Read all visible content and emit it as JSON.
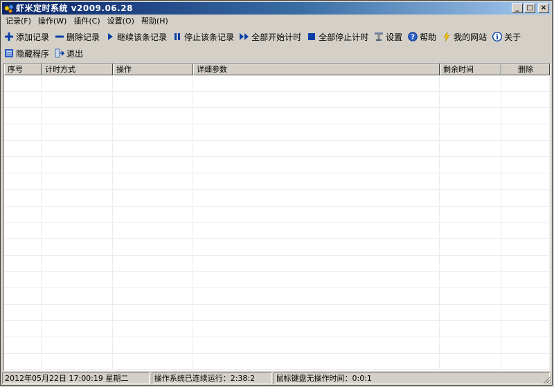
{
  "window": {
    "title": "虾米定时系统 v2009.06.28",
    "controls": {
      "minimize": "_",
      "maximize": "□",
      "close": "×"
    }
  },
  "menu": [
    "记录(F)",
    "操作(W)",
    "插件(C)",
    "设置(O)",
    "帮助(H)"
  ],
  "toolbar1": [
    {
      "label": "添加记录",
      "icon": "plus-icon"
    },
    {
      "label": "删除记录",
      "icon": "minus-icon"
    },
    {
      "label": "继续该条记录",
      "icon": "play-icon"
    },
    {
      "label": "停止该条记录",
      "icon": "pause-icon"
    },
    {
      "label": "全部开始计时",
      "icon": "fast-forward-icon"
    },
    {
      "label": "全部停止计时",
      "icon": "stop-icon"
    },
    {
      "label": "设置",
      "icon": "settings-icon"
    },
    {
      "label": "帮助",
      "icon": "help-icon"
    },
    {
      "label": "我的网站",
      "icon": "lightning-icon"
    },
    {
      "label": "关于",
      "icon": "info-icon"
    }
  ],
  "toolbar2": [
    {
      "label": "隐藏程序",
      "icon": "hide-icon"
    },
    {
      "label": "退出",
      "icon": "exit-icon"
    }
  ],
  "table": {
    "columns": [
      "序号",
      "计时方式",
      "操作",
      "详细参数",
      "剩余时间",
      "删除"
    ],
    "rows": []
  },
  "status": {
    "datetime": "2012年05月22日 17:00:19 星期二",
    "uptime": "操作系统已连续运行：2:38:2",
    "idle": "鼠标键盘无操作时间：0:0:1"
  },
  "colors": {
    "title_start": "#0a246a",
    "title_end": "#a6caf0",
    "icon_blue": "#0a3fa8",
    "window_bg": "#d4d0c8"
  }
}
